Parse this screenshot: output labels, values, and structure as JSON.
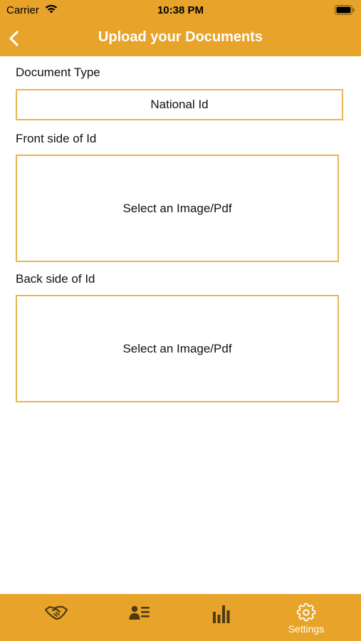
{
  "status_bar": {
    "carrier": "Carrier",
    "time": "10:38 PM"
  },
  "nav": {
    "title": "Upload your Documents",
    "back_icon": "chevron-left-icon"
  },
  "form": {
    "document_type_label": "Document Type",
    "document_type_value": "National Id",
    "front_label": "Front side of Id",
    "front_placeholder": "Select an Image/Pdf",
    "back_label": "Back side of Id",
    "back_placeholder": "Select an Image/Pdf"
  },
  "tab_bar": {
    "tabs": [
      {
        "icon": "handshake-icon",
        "label": ""
      },
      {
        "icon": "contact-list-icon",
        "label": ""
      },
      {
        "icon": "bar-chart-icon",
        "label": ""
      },
      {
        "icon": "gear-icon",
        "label": "Settings"
      }
    ],
    "active_index": 3
  },
  "colors": {
    "accent": "#E7A32A",
    "border": "#E7B655",
    "text": "#111111",
    "tab_icon": "#4E3A10"
  }
}
